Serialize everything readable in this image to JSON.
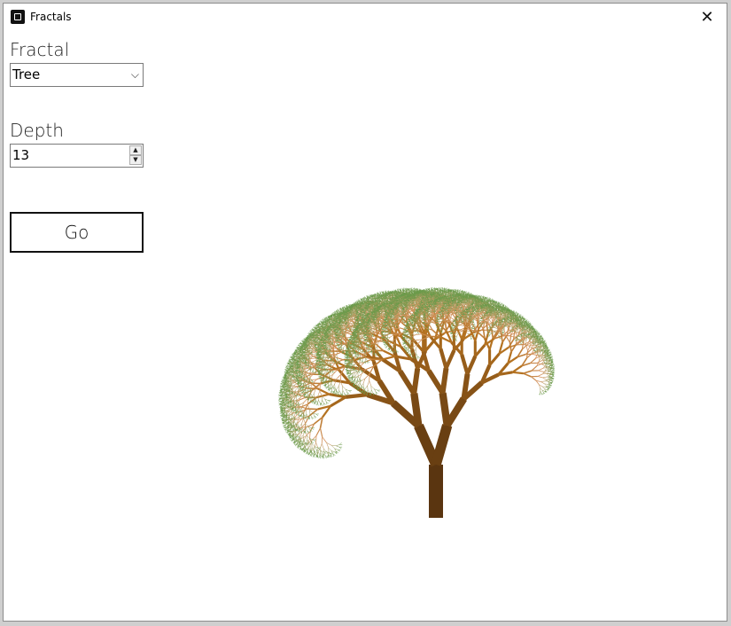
{
  "window": {
    "title": "Fractals",
    "close_glyph": "✕",
    "icon": "app-icon"
  },
  "controls": {
    "fractal_label": "Fractal",
    "fractal_value": "Tree",
    "depth_label": "Depth",
    "depth_value": "13",
    "go_label": "Go"
  },
  "tree": {
    "depth": 13,
    "colors": {
      "trunk": "#5a3510",
      "mid": "#b2701e",
      "light": "#d99a6a",
      "leaf": "#6b9a4a"
    }
  }
}
